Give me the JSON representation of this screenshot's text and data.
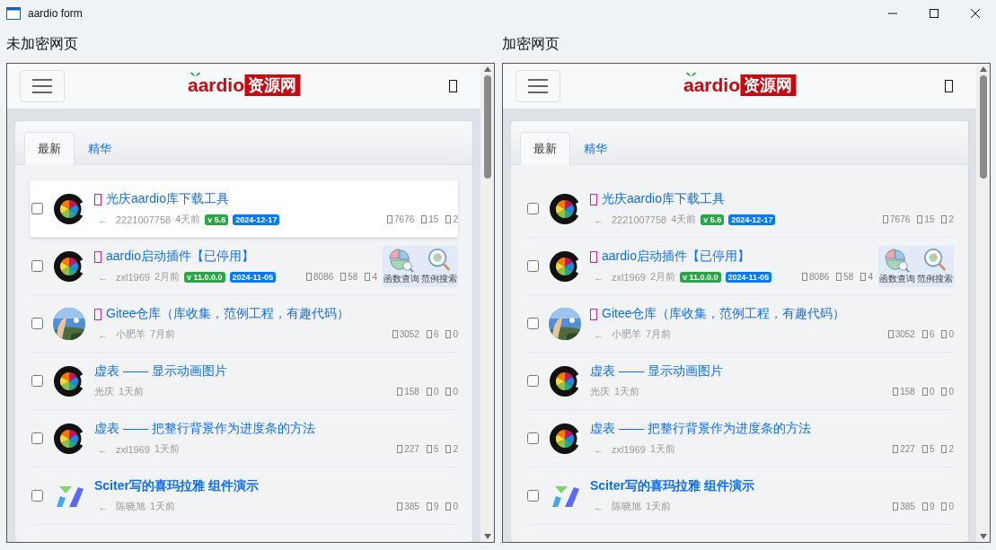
{
  "window": {
    "title": "aardio form"
  },
  "panes": [
    {
      "label": "未加密网页",
      "logo": {
        "latin": "aardio",
        "cjk": "资源网"
      },
      "tabs": [
        {
          "label": "最新",
          "selected": true
        },
        {
          "label": "精华",
          "selected": false
        }
      ],
      "rows": [
        {
          "avatar": {
            "kind": "c_logo"
          },
          "title_icon": true,
          "title": "光庆aardio库下载工具",
          "bold": false,
          "highlighted": true,
          "checked": false,
          "arrow": "←",
          "author": "2221007758",
          "time": "4天前",
          "version": "v 5.6",
          "date": "2024-12-17",
          "stats": [
            "7676",
            "15",
            "2"
          ]
        },
        {
          "avatar": {
            "kind": "c_logo"
          },
          "title_icon": true,
          "title": "aardio启动插件【已停用】",
          "bold": false,
          "highlighted": false,
          "checked": false,
          "arrow": "←",
          "author": "zxl1969",
          "time": "2月前",
          "version": "v 11.0.0.0",
          "date": "2024-11-05",
          "stats": [
            "8086",
            "58",
            "4"
          ],
          "tools": [
            "函数查询",
            "范例搜索"
          ]
        },
        {
          "title_icon": true,
          "title": "Gitee仓库（库收集，范例工程，有趣代码）",
          "bold": false,
          "highlighted": false,
          "checked": false,
          "arrow": "←",
          "author": "小肥羊",
          "time": "7月前",
          "stats": [
            "3052",
            "6",
            "0"
          ]
        },
        {
          "avatar": {
            "kind": "c_logo"
          },
          "title_icon": false,
          "title": "虚表 —— 显示动画图片",
          "bold": false,
          "highlighted": false,
          "checked": false,
          "author": "光庆",
          "time": "1天前",
          "stats": [
            "158",
            "0",
            "0"
          ]
        },
        {
          "avatar": {
            "kind": "c_logo"
          },
          "title_icon": false,
          "title": "虚表 —— 把整行背景作为进度条的方法",
          "bold": false,
          "highlighted": false,
          "checked": false,
          "arrow": "←",
          "author": "zxl1969",
          "time": "1天前",
          "stats": [
            "227",
            "5",
            "2"
          ]
        },
        {
          "avatar": {
            "kind": "y_logo"
          },
          "title_icon": false,
          "title": "Sciter写的喜玛拉雅 组件演示",
          "bold": true,
          "highlighted": false,
          "checked": false,
          "arrow": "←",
          "author": "陈晓旭",
          "time": "1天前",
          "stats": [
            "385",
            "9",
            "0"
          ]
        }
      ]
    },
    {
      "label": "加密网页",
      "logo": {
        "latin": "aardio",
        "cjk": "资源网"
      },
      "tabs": [
        {
          "label": "最新",
          "selected": true
        },
        {
          "label": "精华",
          "selected": false
        }
      ],
      "rows": [
        {
          "avatar": {
            "kind": "c_logo"
          },
          "title_icon": true,
          "title": "光庆aardio库下载工具",
          "bold": false,
          "highlighted": false,
          "checked": false,
          "arrow": "←",
          "author": "2221007758",
          "time": "4天前",
          "version": "v 5.6",
          "date": "2024-12-17",
          "stats": [
            "7676",
            "15",
            "2"
          ]
        },
        {
          "avatar": {
            "kind": "c_logo"
          },
          "title_icon": true,
          "title": "aardio启动插件【已停用】",
          "bold": false,
          "highlighted": false,
          "checked": false,
          "arrow": "←",
          "author": "zxl1969",
          "time": "2月前",
          "version": "v 11.0.0.0",
          "date": "2024-11-05",
          "stats": [
            "8086",
            "58",
            "4"
          ],
          "tools": [
            "函数查询",
            "范例搜索"
          ]
        },
        {
          "title_icon": true,
          "title": "Gitee仓库（库收集，范例工程，有趣代码）",
          "bold": false,
          "highlighted": false,
          "checked": false,
          "arrow": "←",
          "author": "小肥羊",
          "time": "7月前",
          "stats": [
            "3052",
            "6",
            "0"
          ]
        },
        {
          "avatar": {
            "kind": "c_logo"
          },
          "title_icon": false,
          "title": "虚表 —— 显示动画图片",
          "bold": false,
          "highlighted": false,
          "checked": false,
          "author": "光庆",
          "time": "1天前",
          "stats": [
            "158",
            "0",
            "0"
          ]
        },
        {
          "avatar": {
            "kind": "c_logo"
          },
          "title_icon": false,
          "title": "虚表 —— 把整行背景作为进度条的方法",
          "bold": false,
          "highlighted": false,
          "checked": false,
          "arrow": "←",
          "author": "zxl1969",
          "time": "1天前",
          "stats": [
            "227",
            "5",
            "2"
          ]
        },
        {
          "avatar": {
            "kind": "y_logo"
          },
          "title_icon": false,
          "title": "Sciter写的喜玛拉雅 组件演示",
          "bold": true,
          "highlighted": false,
          "checked": false,
          "arrow": "←",
          "author": "陈晓旭",
          "time": "1天前",
          "stats": [
            "385",
            "9",
            "0"
          ]
        }
      ]
    }
  ]
}
